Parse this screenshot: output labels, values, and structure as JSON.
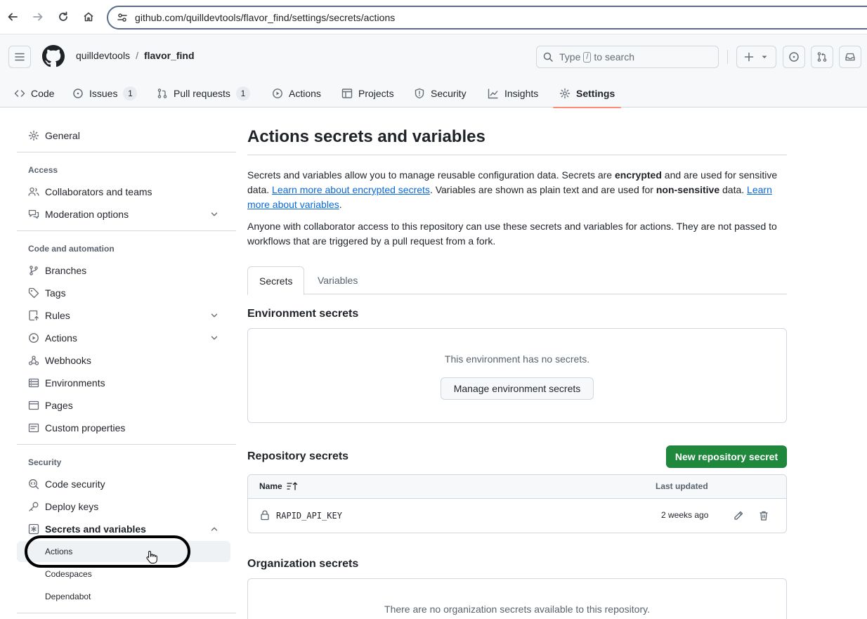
{
  "browser": {
    "url": "github.com/quilldevtools/flavor_find/settings/secrets/actions"
  },
  "header": {
    "owner": "quilldevtools",
    "separator": "/",
    "repo": "flavor_find",
    "search_prefix": "Type",
    "search_key": "/",
    "search_suffix": "to search"
  },
  "repo_tabs": [
    {
      "label": "Code"
    },
    {
      "label": "Issues",
      "count": "1"
    },
    {
      "label": "Pull requests",
      "count": "1"
    },
    {
      "label": "Actions"
    },
    {
      "label": "Projects"
    },
    {
      "label": "Security"
    },
    {
      "label": "Insights"
    },
    {
      "label": "Settings",
      "selected": true
    }
  ],
  "sidebar": {
    "general": "General",
    "groups": {
      "access": "Access",
      "code_automation": "Code and automation",
      "security": "Security"
    },
    "access_items": [
      "Collaborators and teams",
      "Moderation options"
    ],
    "code_items": [
      "Branches",
      "Tags",
      "Rules",
      "Actions",
      "Webhooks",
      "Environments",
      "Pages",
      "Custom properties"
    ],
    "security_items": [
      "Code security",
      "Deploy keys",
      "Secrets and variables"
    ],
    "secrets_sub": [
      "Actions",
      "Codespaces",
      "Dependabot"
    ]
  },
  "main": {
    "title": "Actions secrets and variables",
    "intro": {
      "p1_a": "Secrets and variables allow you to manage reusable configuration data. Secrets are ",
      "p1_b": "encrypted",
      "p1_c": " and are used for sensitive data. ",
      "p1_link1": "Learn more about encrypted secrets",
      "p1_d": ". Variables are shown as plain text and are used for ",
      "p1_e": "non-sensitive",
      "p1_f": " data. ",
      "p1_link2": "Learn more about variables",
      "p1_g": ".",
      "p2": "Anyone with collaborator access to this repository can use these secrets and variables for actions. They are not passed to workflows that are triggered by a pull request from a fork."
    },
    "tabs": [
      "Secrets",
      "Variables"
    ],
    "env_secrets": {
      "heading": "Environment secrets",
      "empty": "This environment has no secrets.",
      "button": "Manage environment secrets"
    },
    "repo_secrets": {
      "heading": "Repository secrets",
      "new_button": "New repository secret",
      "col_name": "Name",
      "col_updated": "Last updated",
      "rows": [
        {
          "name": "RAPID_API_KEY",
          "updated": "2 weeks ago"
        }
      ]
    },
    "org_secrets": {
      "heading": "Organization secrets",
      "empty": "There are no organization secrets available to this repository."
    }
  },
  "colors": {
    "accent_underline": "#fd8c73",
    "link": "#0969da",
    "primary_button": "#1f883d",
    "active_bar": "#0969da"
  }
}
